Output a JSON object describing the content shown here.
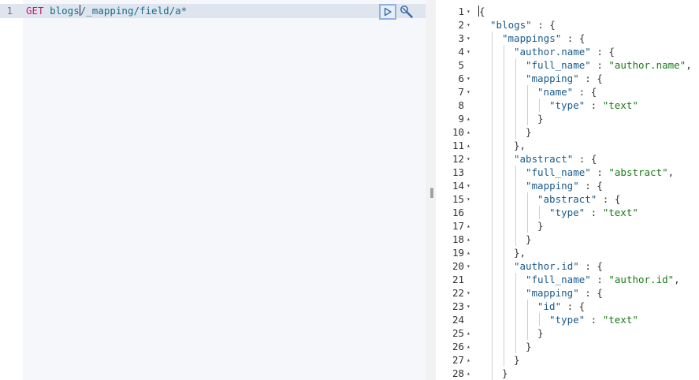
{
  "request": {
    "line_number": "1",
    "method": "GET",
    "path_before_cursor": "blogs",
    "path_after_cursor": "/_mapping/field/a*"
  },
  "actions": {
    "run_icon": "play-icon",
    "settings_icon": "wrench-icon"
  },
  "splitter": {
    "handle": "‖"
  },
  "response": {
    "lines": [
      {
        "n": "1",
        "fold": "open",
        "indent": 0,
        "text": "{",
        "kind": "pun"
      },
      {
        "n": "2",
        "fold": "open",
        "indent": 1,
        "key": "\"blogs\"",
        "rest": " : {"
      },
      {
        "n": "3",
        "fold": "open",
        "indent": 2,
        "key": "\"mappings\"",
        "rest": " : {"
      },
      {
        "n": "4",
        "fold": "open",
        "indent": 3,
        "key": "\"author.name\"",
        "rest": " : {"
      },
      {
        "n": "5",
        "fold": "",
        "indent": 4,
        "key": "\"full_name\"",
        "rest": " : ",
        "str": "\"author.name\"",
        "tail": ","
      },
      {
        "n": "6",
        "fold": "open",
        "indent": 4,
        "key": "\"mapping\"",
        "rest": " : {"
      },
      {
        "n": "7",
        "fold": "open",
        "indent": 5,
        "key": "\"name\"",
        "rest": " : {"
      },
      {
        "n": "8",
        "fold": "",
        "indent": 6,
        "key": "\"type\"",
        "rest": " : ",
        "str": "\"text\""
      },
      {
        "n": "9",
        "fold": "close",
        "indent": 5,
        "text": "}",
        "kind": "pun"
      },
      {
        "n": "10",
        "fold": "close",
        "indent": 4,
        "text": "}",
        "kind": "pun"
      },
      {
        "n": "11",
        "fold": "close",
        "indent": 3,
        "text": "},",
        "kind": "pun"
      },
      {
        "n": "12",
        "fold": "open",
        "indent": 3,
        "key": "\"abstract\"",
        "rest": " : {"
      },
      {
        "n": "13",
        "fold": "",
        "indent": 4,
        "key": "\"full_name\"",
        "rest": " : ",
        "str": "\"abstract\"",
        "tail": ","
      },
      {
        "n": "14",
        "fold": "open",
        "indent": 4,
        "key": "\"mapping\"",
        "rest": " : {"
      },
      {
        "n": "15",
        "fold": "open",
        "indent": 5,
        "key": "\"abstract\"",
        "rest": " : {"
      },
      {
        "n": "16",
        "fold": "",
        "indent": 6,
        "key": "\"type\"",
        "rest": " : ",
        "str": "\"text\""
      },
      {
        "n": "17",
        "fold": "close",
        "indent": 5,
        "text": "}",
        "kind": "pun"
      },
      {
        "n": "18",
        "fold": "close",
        "indent": 4,
        "text": "}",
        "kind": "pun"
      },
      {
        "n": "19",
        "fold": "close",
        "indent": 3,
        "text": "},",
        "kind": "pun"
      },
      {
        "n": "20",
        "fold": "open",
        "indent": 3,
        "key": "\"author.id\"",
        "rest": " : {"
      },
      {
        "n": "21",
        "fold": "",
        "indent": 4,
        "key": "\"full_name\"",
        "rest": " : ",
        "str": "\"author.id\"",
        "tail": ","
      },
      {
        "n": "22",
        "fold": "open",
        "indent": 4,
        "key": "\"mapping\"",
        "rest": " : {"
      },
      {
        "n": "23",
        "fold": "open",
        "indent": 5,
        "key": "\"id\"",
        "rest": " : {"
      },
      {
        "n": "24",
        "fold": "",
        "indent": 6,
        "key": "\"type\"",
        "rest": " : ",
        "str": "\"text\""
      },
      {
        "n": "25",
        "fold": "close",
        "indent": 5,
        "text": "}",
        "kind": "pun"
      },
      {
        "n": "26",
        "fold": "close",
        "indent": 4,
        "text": "}",
        "kind": "pun"
      },
      {
        "n": "27",
        "fold": "close",
        "indent": 3,
        "text": "}",
        "kind": "pun"
      },
      {
        "n": "28",
        "fold": "close",
        "indent": 2,
        "text": "}",
        "kind": "pun"
      }
    ]
  }
}
